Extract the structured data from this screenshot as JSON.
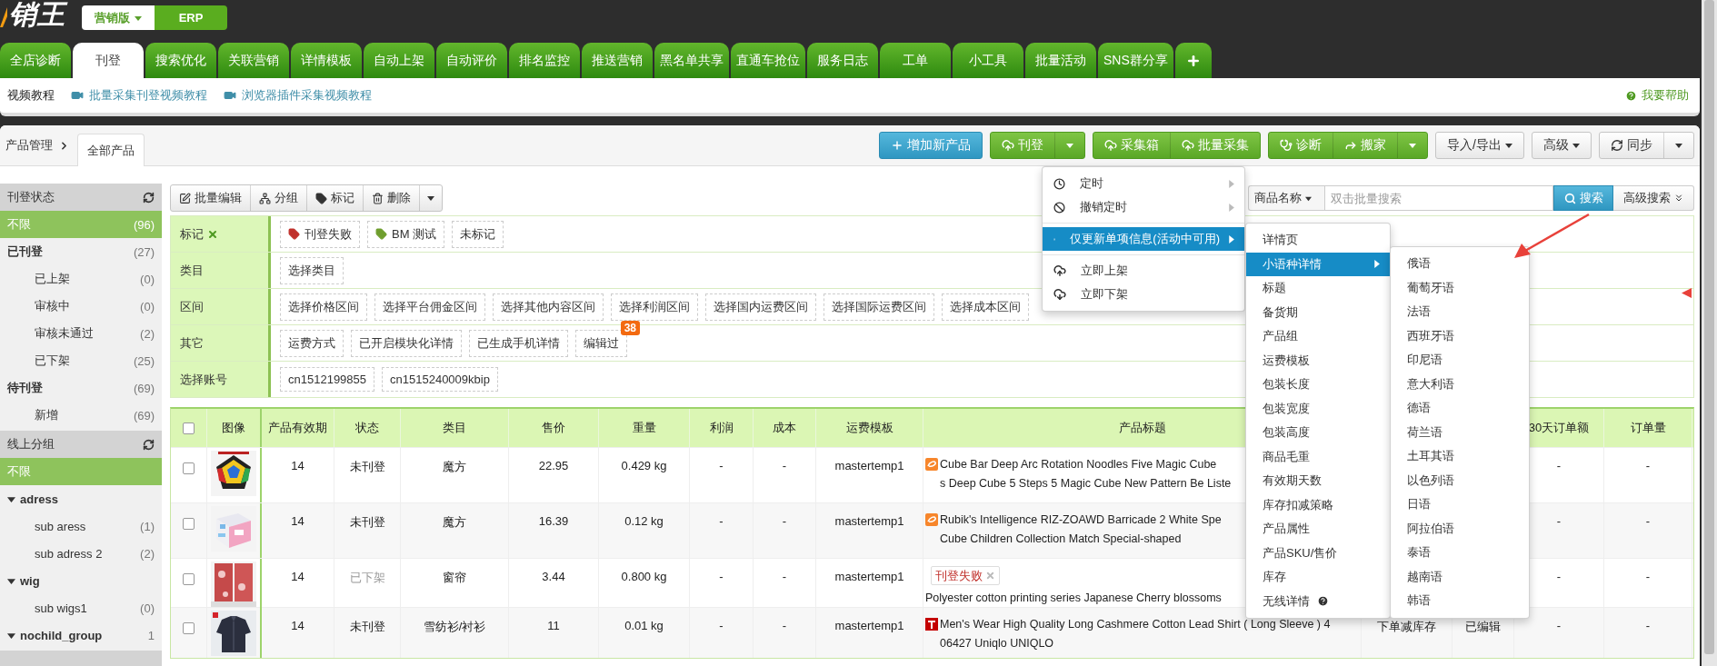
{
  "header": {
    "logo": "销王",
    "edition_switch": [
      {
        "label": "营销版",
        "selected": true,
        "dropdown": true
      },
      {
        "label": "ERP",
        "selected": false,
        "dropdown": false
      }
    ]
  },
  "tabs": [
    {
      "label": "全店诊断",
      "selected": false
    },
    {
      "label": "刊登",
      "selected": true
    },
    {
      "label": "搜索优化",
      "selected": false
    },
    {
      "label": "关联营销",
      "selected": false
    },
    {
      "label": "详情模板",
      "selected": false
    },
    {
      "label": "自动上架",
      "selected": false
    },
    {
      "label": "自动评价",
      "selected": false
    },
    {
      "label": "排名监控",
      "selected": false
    },
    {
      "label": "推送营销",
      "selected": false
    },
    {
      "label": "黑名单共享",
      "selected": false
    },
    {
      "label": "直通车抢位",
      "selected": false
    },
    {
      "label": "服务日志",
      "selected": false
    },
    {
      "label": "工单",
      "selected": false
    },
    {
      "label": "小工具",
      "selected": false
    },
    {
      "label": "批量活动",
      "selected": false
    },
    {
      "label": "SNS群分享",
      "selected": false
    }
  ],
  "subnav": {
    "title": "视频教程",
    "links": [
      "批量采集刊登视频教程",
      "浏览器插件采集视频教程"
    ],
    "help": "我要帮助"
  },
  "panel": {
    "breadcrumb": "产品管理",
    "tab": "全部产品"
  },
  "toolbar": [
    {
      "kind": "primary",
      "buttons": [
        "增加新产品"
      ],
      "split_caret": false,
      "caret": false
    },
    {
      "kind": "success",
      "buttons": [
        "刊登"
      ],
      "split_caret": true,
      "caret": false
    },
    {
      "kind": "success",
      "buttons": [
        "采集箱",
        "批量采集"
      ],
      "split_caret": false,
      "caret": false
    },
    {
      "kind": "success",
      "buttons": [
        "诊断",
        "搬家"
      ],
      "split_caret": true,
      "caret": false
    },
    {
      "kind": "default",
      "buttons": [
        "导入/导出"
      ],
      "split_caret": false,
      "caret": true
    },
    {
      "kind": "default",
      "buttons": [
        "高级"
      ],
      "split_caret": false,
      "caret": true
    },
    {
      "kind": "default",
      "buttons": [
        "同步"
      ],
      "split_caret": true,
      "caret": false
    }
  ],
  "actions": [
    "批量编辑",
    "分组",
    "标记",
    "删除"
  ],
  "search": {
    "field": "商品名称",
    "placeholder": "双击批量搜索",
    "button": "搜索",
    "advanced": "高级搜索"
  },
  "sidebar": [
    {
      "title": "刊登状态",
      "items": [
        {
          "label": "不限",
          "count": "(96)",
          "selected": true
        },
        {
          "label": "已刊登",
          "count": "(27)",
          "selected": false,
          "children": [
            {
              "label": "已上架",
              "count": "(0)",
              "selected": false
            },
            {
              "label": "审核中",
              "count": "(0)",
              "selected": false
            },
            {
              "label": "审核未通过",
              "count": "(2)",
              "selected": false
            },
            {
              "label": "已下架",
              "count": "(25)",
              "selected": false
            }
          ]
        },
        {
          "label": "待刊登",
          "count": "(69)",
          "selected": false,
          "children": [
            {
              "label": "新增",
              "count": "(69)",
              "selected": false
            }
          ]
        }
      ]
    },
    {
      "title": "线上分组",
      "items": [
        {
          "label": "不限",
          "selected": true
        },
        {
          "label": "adress",
          "selected": false,
          "expanded": true,
          "children": [
            {
              "label": "sub aress",
              "count": "(1)",
              "selected": false
            },
            {
              "label": "sub adress 2",
              "count": "(2)",
              "selected": false
            }
          ]
        },
        {
          "label": "wig",
          "selected": false,
          "expanded": true,
          "children": [
            {
              "label": "sub wigs1",
              "count": "(0)",
              "selected": false
            }
          ]
        },
        {
          "label": "nochild_group",
          "count": "1",
          "selected": false,
          "expanded": true
        }
      ]
    }
  ],
  "filters": [
    {
      "label": "标记",
      "clearable": true,
      "chips": [
        {
          "text": "刊登失败",
          "color": "#c0302b"
        },
        {
          "text": "BM 测试",
          "color": "#6f9e2e"
        },
        {
          "text": "未标记"
        }
      ]
    },
    {
      "label": "类目",
      "clearable": false,
      "chips": [
        {
          "text": "选择类目"
        }
      ]
    },
    {
      "label": "区间",
      "clearable": false,
      "chips": [
        {
          "text": "选择价格区间"
        },
        {
          "text": "选择平台佣金区间"
        },
        {
          "text": "选择其他内容区间"
        },
        {
          "text": "选择利润区间"
        },
        {
          "text": "选择国内运费区间"
        },
        {
          "text": "选择国际运费区间"
        },
        {
          "text": "选择成本区间"
        }
      ]
    },
    {
      "label": "其它",
      "clearable": false,
      "chips": [
        {
          "text": "运费方式"
        },
        {
          "text": "已开启模块化详情"
        },
        {
          "text": "已生成手机详情"
        },
        {
          "text": "编辑过",
          "badge": "38"
        }
      ]
    },
    {
      "label": "选择账号",
      "clearable": false,
      "chips": [
        {
          "text": "cn1512199855"
        },
        {
          "text": "cn1515240009kbip"
        }
      ]
    }
  ],
  "table": {
    "all_checked": false,
    "columns": [
      "图像",
      "产品有效期",
      "状态",
      "类目",
      "售价",
      "重量",
      "利润",
      "成本",
      "运费模板",
      "产品标题",
      "30天订单额",
      "订单量"
    ],
    "rows": [
      {
        "checked": false,
        "validity": "14",
        "status": "未刊登",
        "status_muted": false,
        "category": "魔方",
        "price": "22.95",
        "weight": "0.429 kg",
        "profit": "-",
        "cost": "-",
        "shipping_template": "mastertemp1",
        "title_lines": [
          "Cube Bar Deep Arc Rotation Noodles Five Magic Cube",
          "s Deep Cube 5 Steps 5 Magic Cube New Pattern Be Liste"
        ],
        "orders_30d": "-",
        "order_count": "-"
      },
      {
        "checked": false,
        "validity": "14",
        "status": "未刊登",
        "status_muted": false,
        "category": "魔方",
        "price": "16.39",
        "weight": "0.12 kg",
        "profit": "-",
        "cost": "-",
        "shipping_template": "mastertemp1",
        "title_lines": [
          "Rubik's Intelligence RIZ-ZOAWD Barricade 2 White Spe",
          "Cube Children Collection Match Special-shaped"
        ],
        "orders_30d": "-",
        "order_count": "-"
      },
      {
        "checked": false,
        "validity": "14",
        "status": "已下架",
        "status_muted": true,
        "category": "窗帘",
        "price": "3.44",
        "weight": "0.800 kg",
        "profit": "-",
        "cost": "-",
        "shipping_template": "mastertemp1",
        "tag": "刊登失败",
        "title_lines": [
          "Polyester cotton printing series Japanese Cherry blossoms"
        ],
        "orders_30d": "-",
        "order_count": "-"
      },
      {
        "checked": false,
        "validity": "14",
        "status": "未刊登",
        "status_muted": false,
        "category": "雪纺衫/衬衫",
        "price": "11",
        "weight": "0.01 kg",
        "profit": "-",
        "cost": "-",
        "shipping_template": "mastertemp1",
        "title_lines": [
          "Men's Wear High Quality Long Cashmere Cotton Lead Shirt ( Long Sleeve ) 4",
          "06427 Uniqlo UNIQLO"
        ],
        "column_12": "下单减库存",
        "column_13": "已编辑",
        "orders_30d": "-",
        "order_count": "-"
      }
    ]
  },
  "publish_menu": {
    "groups": [
      [
        {
          "label": "定时",
          "has_submenu": true,
          "selected": false
        },
        {
          "label": "撤销定时",
          "has_submenu": true,
          "selected": false
        }
      ],
      [
        {
          "label": "仅更新单项信息(活动中可用)",
          "has_submenu": true,
          "selected": true
        }
      ],
      [
        {
          "label": "立即上架",
          "has_submenu": false,
          "selected": false
        },
        {
          "label": "立即下架",
          "has_submenu": false,
          "selected": false
        }
      ]
    ]
  },
  "field_submenu": {
    "items": [
      {
        "label": "详情页",
        "has_submenu": false,
        "selected": false,
        "help": false
      },
      {
        "label": "小语种详情",
        "has_submenu": true,
        "selected": true,
        "help": false
      },
      {
        "label": "标题",
        "has_submenu": false,
        "selected": false,
        "help": false
      },
      {
        "label": "备货期",
        "has_submenu": false,
        "selected": false,
        "help": false
      },
      {
        "label": "产品组",
        "has_submenu": false,
        "selected": false,
        "help": false
      },
      {
        "label": "运费模板",
        "has_submenu": false,
        "selected": false,
        "help": false
      },
      {
        "label": "包装长度",
        "has_submenu": false,
        "selected": false,
        "help": false
      },
      {
        "label": "包装宽度",
        "has_submenu": false,
        "selected": false,
        "help": false
      },
      {
        "label": "包装高度",
        "has_submenu": false,
        "selected": false,
        "help": false
      },
      {
        "label": "商品毛重",
        "has_submenu": false,
        "selected": false,
        "help": false
      },
      {
        "label": "有效期天数",
        "has_submenu": false,
        "selected": false,
        "help": false
      },
      {
        "label": "库存扣减策略",
        "has_submenu": false,
        "selected": false,
        "help": false
      },
      {
        "label": "产品属性",
        "has_submenu": false,
        "selected": false,
        "help": false
      },
      {
        "label": "产品SKU/售价",
        "has_submenu": false,
        "selected": false,
        "help": false
      },
      {
        "label": "库存",
        "has_submenu": false,
        "selected": false,
        "help": false
      },
      {
        "label": "无线详情",
        "has_submenu": false,
        "selected": false,
        "help": true
      }
    ]
  },
  "language_submenu": {
    "items": [
      {
        "label": "俄语",
        "selected": false
      },
      {
        "label": "葡萄牙语",
        "selected": false
      },
      {
        "label": "法语",
        "selected": false
      },
      {
        "label": "西班牙语",
        "selected": false
      },
      {
        "label": "印尼语",
        "selected": false
      },
      {
        "label": "意大利语",
        "selected": false
      },
      {
        "label": "德语",
        "selected": false
      },
      {
        "label": "荷兰语",
        "selected": false
      },
      {
        "label": "土耳其语",
        "selected": false
      },
      {
        "label": "以色列语",
        "selected": false
      },
      {
        "label": "日语",
        "selected": false
      },
      {
        "label": "阿拉伯语",
        "selected": false
      },
      {
        "label": "泰语",
        "selected": false
      },
      {
        "label": "越南语",
        "selected": false
      },
      {
        "label": "韩语",
        "selected": false
      }
    ]
  }
}
